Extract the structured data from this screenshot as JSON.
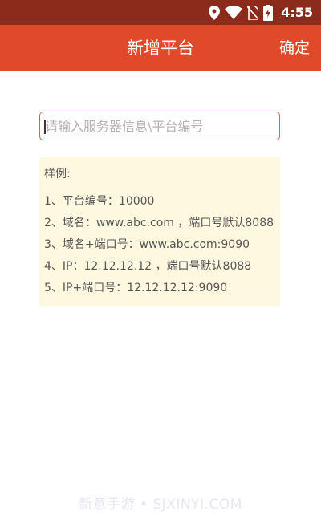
{
  "status_bar": {
    "time": "4:55",
    "icons": [
      "location-icon",
      "wifi-icon",
      "no-sim-icon",
      "battery-charging-icon"
    ]
  },
  "app_bar": {
    "title": "新增平台",
    "confirm_label": "确定"
  },
  "server_input": {
    "placeholder": "请输入服务器信息\\平台编号",
    "value": ""
  },
  "examples": {
    "title": "样例:",
    "lines": [
      "1、平台编号：10000",
      "2、域名：www.abc.com ，端口号默认8088",
      "3、域名+端口号：www.abc.com:9090",
      "4、IP：12.12.12.12 ，端口号默认8088",
      "5、IP+端口号：12.12.12.12:9090"
    ]
  },
  "watermark": "新意手游 • SJXINYI.COM",
  "colors": {
    "status_bar": "#8a2b1b",
    "app_bar": "#e04a2a",
    "input_border": "#c96a50",
    "examples_bg": "#fff8e1"
  }
}
